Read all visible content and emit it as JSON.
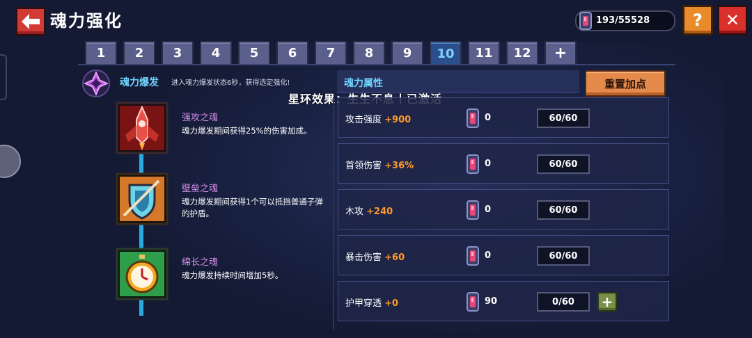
{
  "header": {
    "title": "魂力强化",
    "currency": "193/55528",
    "help_label": "?",
    "close_label": "✕",
    "back_label": "🡐"
  },
  "tabs": [
    "1",
    "2",
    "3",
    "4",
    "5",
    "6",
    "7",
    "8",
    "9",
    "10",
    "11",
    "12",
    "+"
  ],
  "active_tab": "10",
  "burst": {
    "title": "魂力爆发",
    "desc": "进入魂力爆发状态6秒，获得选定强化!"
  },
  "souls": [
    {
      "name": "强攻之魂",
      "desc": "魂力爆发期间获得25%的伤害加成。",
      "icon": "rocket-icon"
    },
    {
      "name": "壁垒之魂",
      "desc": "魂力爆发期间获得1个可以抵挡普通子弹的护盾。",
      "icon": "shield-icon"
    },
    {
      "name": "绵长之魂",
      "desc": "魂力爆发持续时间增加5秒。",
      "icon": "stopwatch-icon"
    }
  ],
  "star_effect": "星环效果：生生不息丨已激活",
  "attributes": {
    "header": "魂力属性",
    "reset_label": "重置加点",
    "rows": [
      {
        "name": "攻击强度",
        "bonus": "+900",
        "cost": "0",
        "level": "60/60"
      },
      {
        "name": "首领伤害",
        "bonus": "+36%",
        "cost": "0",
        "level": "60/60"
      },
      {
        "name": "木攻",
        "bonus": "+240",
        "cost": "0",
        "level": "60/60"
      },
      {
        "name": "暴击伤害",
        "bonus": "+60",
        "cost": "0",
        "level": "60/60"
      },
      {
        "name": "护甲穿透",
        "bonus": "+0",
        "cost": "90",
        "level": "0/60",
        "plus": "+"
      }
    ]
  },
  "colors": {
    "accent_cyan": "#6fd3ff",
    "bonus_orange": "#ff9a2b",
    "soul_name_purple": "#d48ce8",
    "reset_orange": "#e48b4c"
  }
}
